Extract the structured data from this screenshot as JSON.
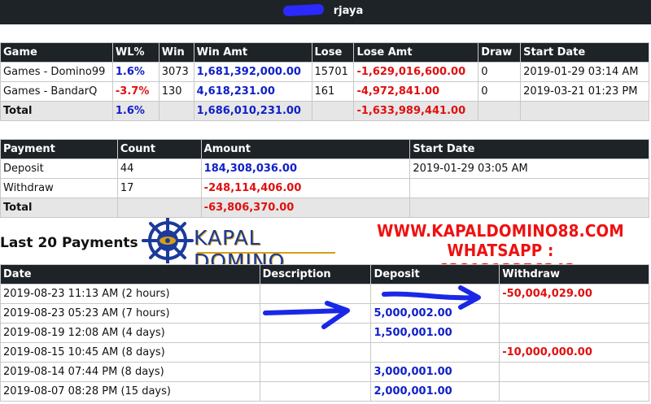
{
  "header": {
    "title_suffix": "rjaya"
  },
  "games": {
    "columns": [
      "Game",
      "WL%",
      "Win",
      "Win Amt",
      "Lose",
      "Lose Amt",
      "Draw",
      "Start Date"
    ],
    "rows": [
      {
        "game": "Games - Domino99",
        "wl": "1.6%",
        "win": "3073",
        "win_amt": "1,681,392,000.00",
        "lose": "15701",
        "lose_amt": "-1,629,016,600.00",
        "draw": "0",
        "start": "2019-01-29 03:14 AM"
      },
      {
        "game": "Games - BandarQ",
        "wl": "-3.7%",
        "win": "130",
        "win_amt": "4,618,231.00",
        "lose": "161",
        "lose_amt": "-4,972,841.00",
        "draw": "0",
        "start": "2019-03-21 01:23 PM"
      }
    ],
    "total": {
      "label": "Total",
      "wl": "1.6%",
      "win_amt": "1,686,010,231.00",
      "lose_amt": "-1,633,989,441.00"
    }
  },
  "payments": {
    "columns": [
      "Payment",
      "Count",
      "Amount",
      "Start Date"
    ],
    "rows": [
      {
        "payment": "Deposit",
        "count": "44",
        "amount": "184,308,036.00",
        "start": "2019-01-29 03:05 AM"
      },
      {
        "payment": "Withdraw",
        "count": "17",
        "amount": "-248,114,406.00",
        "start": ""
      }
    ],
    "total": {
      "label": "Total",
      "amount": "-63,806,370.00"
    }
  },
  "last_payments": {
    "title": "Last 20 Payments",
    "columns": [
      "Date",
      "Description",
      "Deposit",
      "Withdraw"
    ],
    "rows": [
      {
        "date": "2019-08-23 11:13 AM (2 hours)",
        "desc": "",
        "deposit": "",
        "withdraw": "-50,004,029.00"
      },
      {
        "date": "2019-08-23 05:23 AM (7 hours)",
        "desc": "",
        "deposit": "5,000,002.00",
        "withdraw": ""
      },
      {
        "date": "2019-08-19 12:08 AM (4 days)",
        "desc": "",
        "deposit": "1,500,001.00",
        "withdraw": ""
      },
      {
        "date": "2019-08-15 10:45 AM (8 days)",
        "desc": "",
        "deposit": "",
        "withdraw": "-10,000,000.00"
      },
      {
        "date": "2019-08-14 07:44 PM (8 days)",
        "desc": "",
        "deposit": "3,000,001.00",
        "withdraw": ""
      },
      {
        "date": "2019-08-07 08:28 PM (15 days)",
        "desc": "",
        "deposit": "2,000,001.00",
        "withdraw": ""
      }
    ]
  },
  "overlay": {
    "logo_text": "KAPAL DOMINO",
    "promo_line1": "WWW.KAPALDOMINO88.COM",
    "promo_line2": "WHATSAPP : +6281212356343"
  },
  "colors": {
    "header_bg": "#1e2328",
    "positive": "#1020c8",
    "negative": "#e01010",
    "total_bg": "#e6e6e6",
    "logo_blue": "#1b3a9a",
    "logo_gold": "#d4a017",
    "promo": "#e11111"
  }
}
